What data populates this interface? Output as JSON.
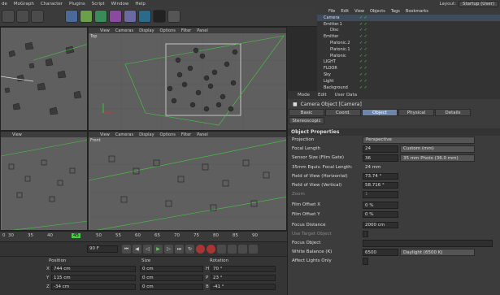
{
  "menubar": {
    "items": [
      "de",
      "MoGraph",
      "Character",
      "Plugins",
      "Script",
      "Window",
      "Help"
    ],
    "layout_label": "Layout:",
    "layout_value": "Startup (User)"
  },
  "viewport_menu": [
    "View",
    "Cameras",
    "Display",
    "Options",
    "Filter",
    "Panel"
  ],
  "viewports": {
    "top_right_label": "Top",
    "bottom_right_label": "Front"
  },
  "object_manager": {
    "menu": [
      "File",
      "Edit",
      "View",
      "Objects",
      "Tags",
      "Bookmarks"
    ],
    "objects": [
      {
        "name": "Camera",
        "indent": 0,
        "selected": true
      },
      {
        "name": "Emitter.1",
        "indent": 0,
        "selected": false
      },
      {
        "name": "Disc",
        "indent": 1,
        "selected": false
      },
      {
        "name": "Emitter",
        "indent": 0,
        "selected": false
      },
      {
        "name": "Platonic.2",
        "indent": 1,
        "selected": false
      },
      {
        "name": "Platonic.1",
        "indent": 1,
        "selected": false
      },
      {
        "name": "Platonic",
        "indent": 1,
        "selected": false
      },
      {
        "name": "LIGHT",
        "indent": 0,
        "selected": false
      },
      {
        "name": "FLOOR",
        "indent": 0,
        "selected": false
      },
      {
        "name": "Sky",
        "indent": 0,
        "selected": false
      },
      {
        "name": "Light",
        "indent": 0,
        "selected": false
      },
      {
        "name": "Background",
        "indent": 0,
        "selected": false
      }
    ]
  },
  "attributes": {
    "menu": [
      "Mode",
      "Edit",
      "User Data"
    ],
    "title": "Camera Object [Camera]",
    "tabs": [
      {
        "label": "Basic",
        "active": false
      },
      {
        "label": "Coord.",
        "active": false
      },
      {
        "label": "Object",
        "active": true
      },
      {
        "label": "Physical",
        "active": false
      },
      {
        "label": "Details",
        "active": false
      },
      {
        "label": "Stereoscopic",
        "active": false
      }
    ],
    "section": "Object Properties",
    "projection_label": "Projection",
    "projection_value": "Perspective",
    "focal_length_label": "Focal Length",
    "focal_length_value": "24",
    "focal_length_preset": "Custom (mm)",
    "sensor_label": "Sensor Size (Film Gate)",
    "sensor_value": "36",
    "sensor_preset": "35 mm Photo (36.0 mm)",
    "equiv_label": "35mm Equiv. Focal Length:",
    "equiv_value": "24 mm",
    "fov_h_label": "Field of View (Horizontal)",
    "fov_h_value": "73.74 °",
    "fov_v_label": "Field of View (Vertical)",
    "fov_v_value": "58.716 °",
    "zoom_label": "Zoom",
    "zoom_value": "1",
    "film_x_label": "Film Offset X",
    "film_x_value": "0 %",
    "film_y_label": "Film Offset Y",
    "film_y_value": "0 %",
    "focus_dist_label": "Focus Distance",
    "focus_dist_value": "2000 cm",
    "use_target_label": "Use Target Object",
    "focus_obj_label": "Focus Object",
    "wb_label": "White Balance (K)",
    "wb_value": "6500",
    "wb_preset": "Daylight (6500 K)",
    "affect_label": "Affect Lights Only"
  },
  "timeline": {
    "ticks": [
      "0",
      "30",
      "35",
      "40",
      "45",
      "50",
      "55",
      "60",
      "65",
      "70",
      "75",
      "80",
      "85",
      "90"
    ],
    "marker": "45"
  },
  "transport": {
    "field": "90 F"
  },
  "coords": {
    "headers": [
      "Position",
      "Size",
      "Rotation"
    ],
    "rows": [
      {
        "axis": "X",
        "pos": "744 cm",
        "size": "0 cm",
        "rot_axis": "H",
        "rot": "70 °"
      },
      {
        "axis": "Y",
        "pos": "115 cm",
        "size": "0 cm",
        "rot_axis": "P",
        "rot": "23 °"
      },
      {
        "axis": "Z",
        "pos": "-34 cm",
        "size": "0 cm",
        "rot_axis": "B",
        "rot": "-41 °"
      }
    ]
  }
}
